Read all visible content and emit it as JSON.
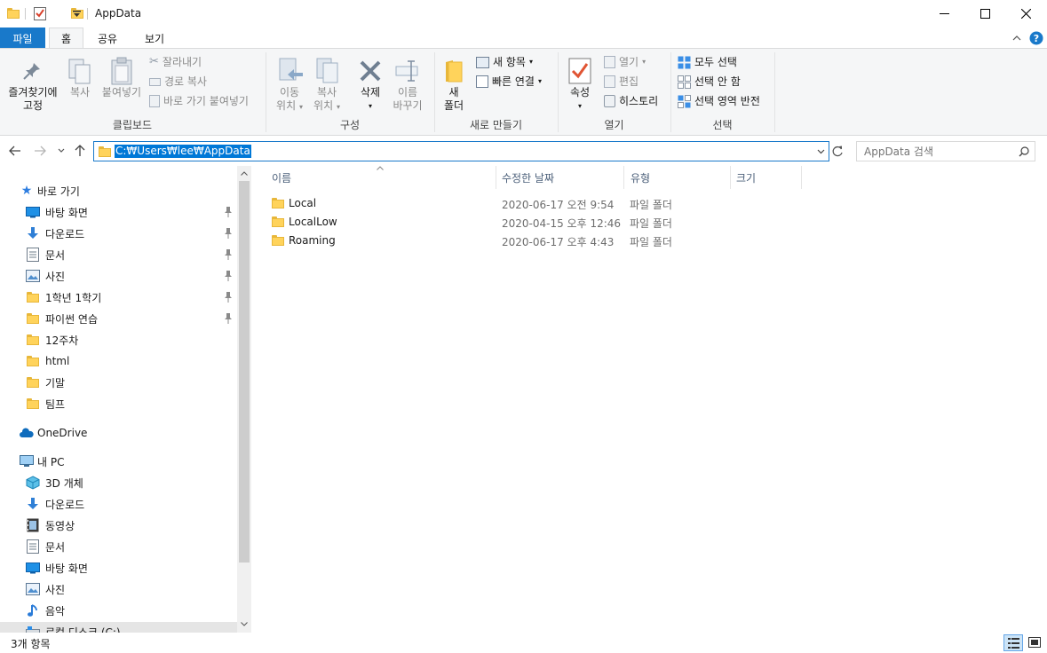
{
  "window": {
    "title": "AppData",
    "minimize_glyph": "—",
    "maximize_glyph": "☐",
    "close_glyph": "✕"
  },
  "tabs": {
    "file": "파일",
    "home": "홈",
    "share": "공유",
    "view": "보기"
  },
  "ribbon": {
    "clipboard": {
      "pin_label_1": "즐겨찾기에",
      "pin_label_2": "고정",
      "copy_label": "복사",
      "paste_label": "붙여넣기",
      "cut_label": "잘라내기",
      "copy_path_label": "경로 복사",
      "paste_shortcut_label": "바로 가기 붙여넣기",
      "group_label": "클립보드"
    },
    "organize": {
      "move_label_1": "이동",
      "move_label_2": "위치",
      "copyto_label_1": "복사",
      "copyto_label_2": "위치",
      "delete_label": "삭제",
      "rename_label_1": "이름",
      "rename_label_2": "바꾸기",
      "group_label": "구성"
    },
    "new": {
      "new_folder_label_1": "새",
      "new_folder_label_2": "폴더",
      "new_item_label": "새 항목",
      "easy_access_label": "빠른 연결",
      "group_label": "새로 만들기"
    },
    "open": {
      "properties_label": "속성",
      "open_label": "열기",
      "edit_label": "편집",
      "history_label": "히스토리",
      "group_label": "열기"
    },
    "select": {
      "select_all_label": "모두 선택",
      "select_none_label": "선택 안 함",
      "invert_label": "선택 영역 반전",
      "group_label": "선택"
    }
  },
  "address": {
    "path": "C:₩Users₩lee₩AppData",
    "search_placeholder": "AppData 검색"
  },
  "nav": {
    "quick_access": "바로 가기",
    "quick_items": [
      {
        "label": "바탕 화면",
        "icon": "desktop-icon",
        "pinned": true
      },
      {
        "label": "다운로드",
        "icon": "download-icon",
        "pinned": true
      },
      {
        "label": "문서",
        "icon": "document-icon",
        "pinned": true
      },
      {
        "label": "사진",
        "icon": "pictures-icon",
        "pinned": true
      },
      {
        "label": "1학년 1학기",
        "icon": "folder-icon",
        "pinned": true
      },
      {
        "label": "파이썬 연습",
        "icon": "folder-icon",
        "pinned": true
      },
      {
        "label": "12주차",
        "icon": "folder-icon",
        "pinned": false
      },
      {
        "label": "html",
        "icon": "folder-icon",
        "pinned": false
      },
      {
        "label": "기말",
        "icon": "folder-icon",
        "pinned": false
      },
      {
        "label": "팀프",
        "icon": "folder-icon",
        "pinned": false
      }
    ],
    "onedrive": "OneDrive",
    "this_pc": "내 PC",
    "pc_items": [
      {
        "label": "3D 개체",
        "icon": "3d-objects-icon"
      },
      {
        "label": "다운로드",
        "icon": "download-icon"
      },
      {
        "label": "동영상",
        "icon": "video-icon"
      },
      {
        "label": "문서",
        "icon": "document-icon"
      },
      {
        "label": "바탕 화면",
        "icon": "desktop-icon"
      },
      {
        "label": "사진",
        "icon": "pictures-icon"
      },
      {
        "label": "음악",
        "icon": "music-icon"
      },
      {
        "label": "로컬 디스크 (C:)",
        "icon": "drive-icon"
      }
    ]
  },
  "columns": {
    "name": "이름",
    "date": "수정한 날짜",
    "type": "유형",
    "size": "크기"
  },
  "files": [
    {
      "name": "Local",
      "date": "2020-06-17 오전 9:54",
      "type": "파일 폴더"
    },
    {
      "name": "LocalLow",
      "date": "2020-04-15 오후 12:46",
      "type": "파일 폴더"
    },
    {
      "name": "Roaming",
      "date": "2020-06-17 오후 4:43",
      "type": "파일 폴더"
    }
  ],
  "status": {
    "item_count": "3개 항목"
  },
  "colors": {
    "accent": "#1979ca",
    "selection": "#0078d7",
    "folder": "#ffd35b"
  }
}
